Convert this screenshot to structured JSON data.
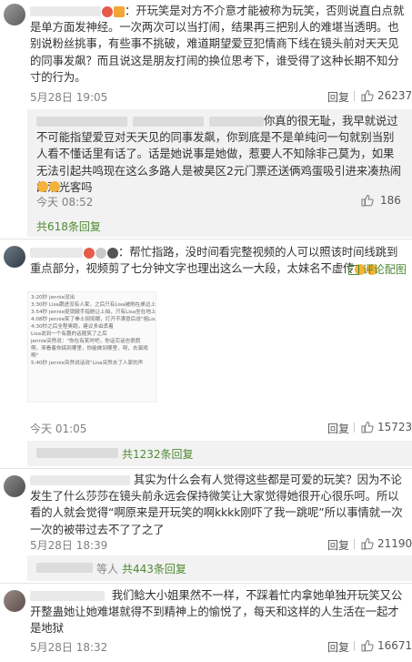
{
  "comments": [
    {
      "text": "：开玩笑是对方不介意才能被称为玩笑，否则说直白点就是单方面发神经。一次两次可以当打闹，结果再三把别人的难堪当透明。也别说粉丝挑事，有些事不挑破，难道期望爱豆犯情商下线在镜头前对天天见的同事发飙？而且说这是朋友打闹的换位思考下，谁受得了这种长期不知分寸的行为。",
      "time": "5月28日 19:05",
      "reply": "回复",
      "likes": "26237",
      "sub": {
        "text": "你真的很无耻，我早就说过不可能指望爱豆对天天见的同事发飙，你到底是不是单纯问一句就别当别人看不懂话里有话了。话是她说事是她做，惹要人不知除非己莫为，如果无法引起共鸣现在这么多路人是被昊区2元门票还送俩鸡蛋吸引进来凑热闹的观光客吗",
        "time": "今天 08:52",
        "likes": "186"
      },
      "replies": "共618条回复"
    },
    {
      "text": "：帮忙指路，没时间看完整视频的人可以照该时间线跳到重点部分，视频剪了七分钟文字也理出这么一大段，太妹名不虚传",
      "comment_label": "评论配图",
      "image_lines": [
        "3:20秒 jennie没出",
        "3:30秒 Lisa跟进没有人家，之后只有Lisa被刷在桌边上",
        "3:54秒 jennie捉锁腿手指她让上拍，只有Lisa坐在地上",
        "4:08秒 jennie笑了拳士拐彻眼，打开不满意后说\"祖Lisa\"",
        "4:30秒之后全程奥跑，建议多由丢着",
        "Lisa说到一个有趣的话题笑了之后",
        "jennie突然说：\"你在有笑时吧，你话完话也很假啊，来看着你搞到哪里，你能做到哪里，呀，去演戏啊\"",
        "5:40秒 jennie突然说话说\"Lisa突然去了人家的声"
      ],
      "time": "今天 01:05",
      "reply": "回复",
      "likes": "15723",
      "replies": "共1232条回复"
    },
    {
      "text": "其实为什么会有人觉得这些都是可爱的玩笑？因为不论发生了什么莎莎在镜头前永远会保持微笑让大家觉得她很开心很乐呵。所以看的人就会觉得“啊原来是开玩笑的啊kkkk刚吓了我一跳呢”所以事情就一次一次的被带过去不了了之了",
      "time": "5月28日 18:39",
      "reply": "回复",
      "likes": "21190",
      "replies_suffix": "等人",
      "replies": "共443条回复"
    },
    {
      "text": "我们鲶大小姐果然不一样，不踩着忙内拿她单独开玩笑又公开整蛊她让她难堪就得不到精神上的愉悦了，每天和这样的人生活在一起才是地狱",
      "time": "5月28日 18:32",
      "reply": "回复",
      "likes": "16671"
    }
  ],
  "icons": [
    "avatar",
    "thumbs-up-icon",
    "image-icon"
  ],
  "colors": {
    "username": "#eb7350",
    "replies": "#4f8a31",
    "meta": "#808080",
    "panel": "#f2f2f2"
  }
}
